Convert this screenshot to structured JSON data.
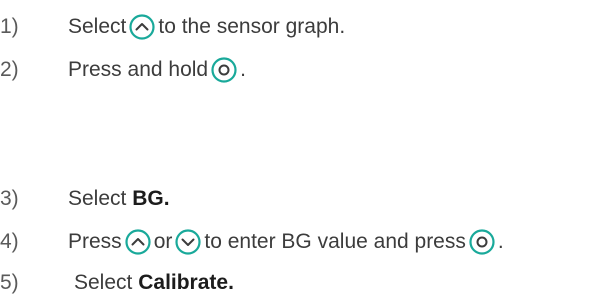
{
  "steps": [
    {
      "num": "1)",
      "a": "Select",
      "b": "to the sensor graph."
    },
    {
      "num": "2)",
      "a": "Press and hold",
      "b": "."
    },
    {
      "num": "3)",
      "a": "Select",
      "bold": "BG."
    },
    {
      "num": "4)",
      "a": "Press",
      "or": "or",
      "b": "to enter BG value and press",
      "c": "."
    },
    {
      "num": "5)",
      "a": "Select",
      "bold": "Calibrate."
    }
  ],
  "icons": {
    "up": "up-arrow-button-icon",
    "down": "down-arrow-button-icon",
    "select": "select-button-icon"
  },
  "colors": {
    "icon_stroke": "#19a99a",
    "text": "#3c3c3c"
  }
}
